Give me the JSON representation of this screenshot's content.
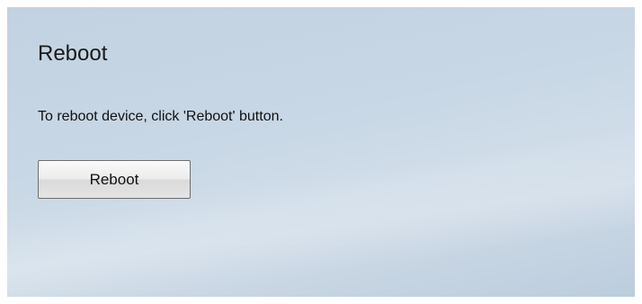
{
  "page": {
    "title": "Reboot",
    "description": "To reboot device, click 'Reboot' button.",
    "reboot_button_label": "Reboot"
  },
  "colors": {
    "background": "#c8d7e5",
    "button_border": "#6f6f6f",
    "text": "#111111"
  }
}
